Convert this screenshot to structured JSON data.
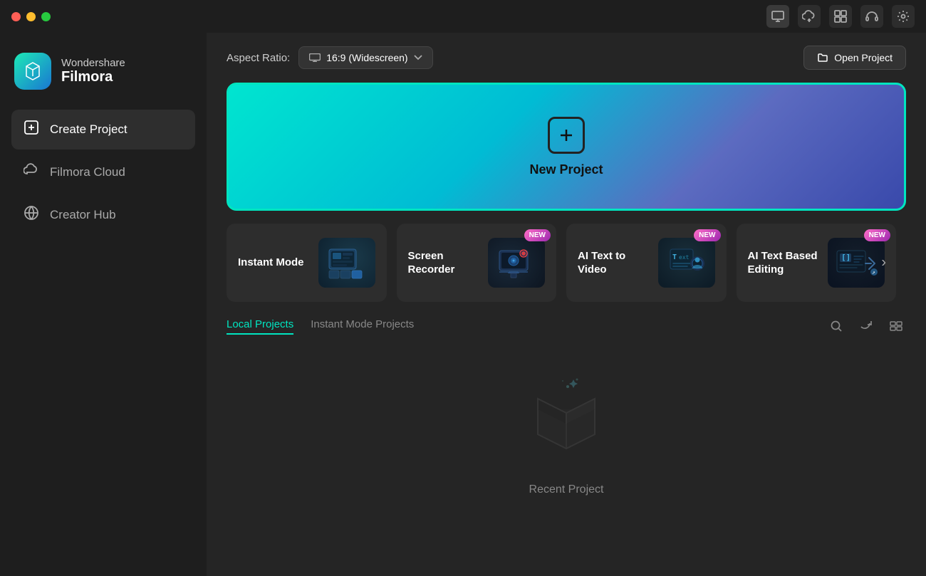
{
  "titlebar": {
    "traffic_lights": [
      "red",
      "yellow",
      "green"
    ],
    "icons": [
      "screen-icon",
      "cloud-upload-icon",
      "grid-icon",
      "headphone-icon",
      "settings-icon"
    ]
  },
  "sidebar": {
    "logo": {
      "brand": "Wondershare",
      "product": "Filmora"
    },
    "nav_items": [
      {
        "id": "create-project",
        "label": "Create Project",
        "icon": "plus-square",
        "active": true
      },
      {
        "id": "filmora-cloud",
        "label": "Filmora Cloud",
        "icon": "cloud",
        "active": false
      },
      {
        "id": "creator-hub",
        "label": "Creator Hub",
        "icon": "globe",
        "active": false
      }
    ]
  },
  "content": {
    "topbar": {
      "aspect_ratio_label": "Aspect Ratio:",
      "aspect_ratio_value": "16:9 (Widescreen)",
      "open_project_label": "Open Project"
    },
    "new_project": {
      "label": "New Project"
    },
    "feature_cards": [
      {
        "id": "instant-mode",
        "label": "Instant Mode",
        "is_new": false
      },
      {
        "id": "screen-recorder",
        "label": "Screen Recorder",
        "is_new": true
      },
      {
        "id": "ai-text-to-video",
        "label": "AI Text to Video",
        "is_new": true
      },
      {
        "id": "ai-text-editing",
        "label": "AI Text Based Editing",
        "is_new": true
      }
    ],
    "projects_tabs": [
      {
        "id": "local-projects",
        "label": "Local Projects",
        "active": true
      },
      {
        "id": "instant-mode-projects",
        "label": "Instant Mode Projects",
        "active": false
      }
    ],
    "empty_state": {
      "label": "Recent Project"
    }
  }
}
